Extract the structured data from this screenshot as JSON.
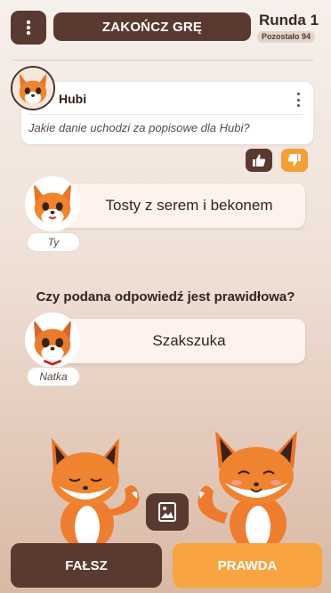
{
  "header": {
    "end_game_label": "ZAKOŃCZ GRĘ",
    "round_label": "Runda 1",
    "remaining_label": "Pozostało 94"
  },
  "question": {
    "author": "Hubi",
    "text": "Jakie danie uchodzi za popisowe dla Hubi?"
  },
  "answers": {
    "user": {
      "text": "Tosty z serem i bekonem",
      "name": "Ty"
    },
    "other": {
      "text": "Szakszuka",
      "name": "Natka"
    }
  },
  "prompt": "Czy podana odpowiedź jest prawidłowa?",
  "actions": {
    "false_label": "FAŁSZ",
    "true_label": "PRAWDA"
  },
  "colors": {
    "primary_brown": "#5a3a30",
    "accent_orange": "#f8a440"
  },
  "icons": {
    "menu": "kebab-menu-icon",
    "thumb_up": "thumb-up-icon",
    "thumb_down": "thumb-down-icon",
    "gallery": "image-icon"
  }
}
